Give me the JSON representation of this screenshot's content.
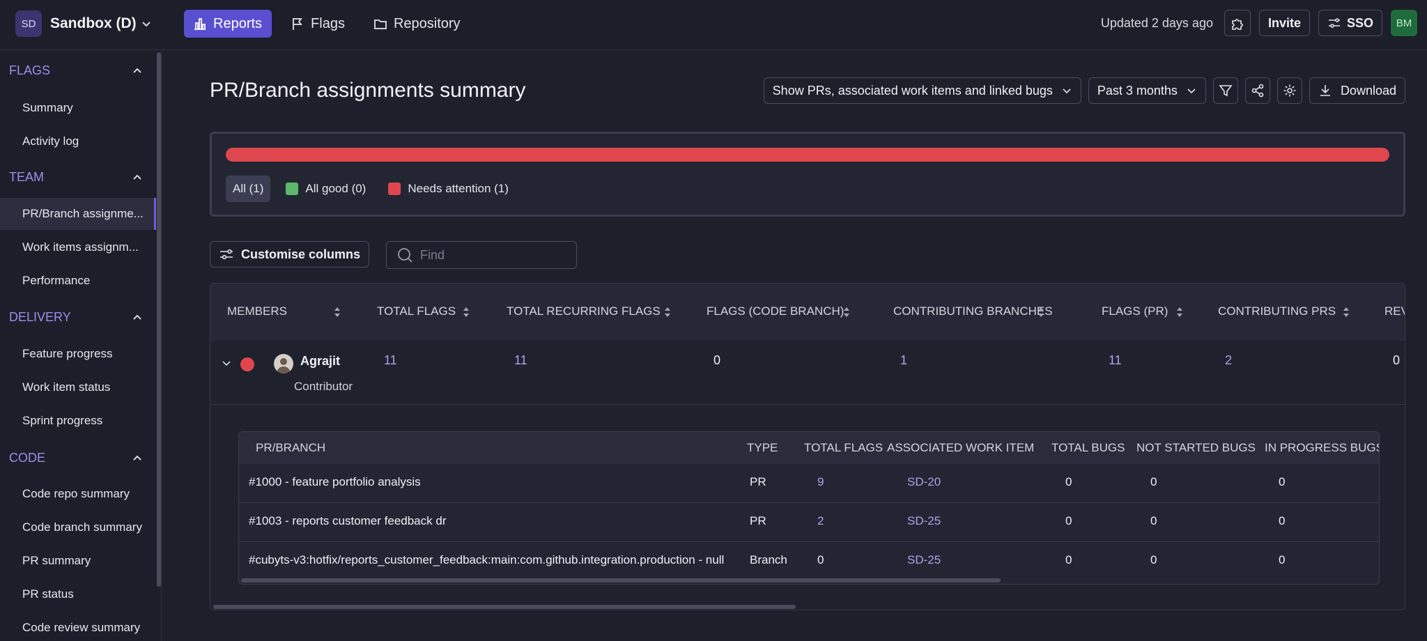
{
  "topbar": {
    "workspace_badge": "SD",
    "workspace_name": "Sandbox (D)",
    "nav": [
      {
        "label": "Reports",
        "icon": "bar-chart-icon",
        "active": true
      },
      {
        "label": "Flags",
        "icon": "flag-icon",
        "active": false
      },
      {
        "label": "Repository",
        "icon": "folder-icon",
        "active": false
      }
    ],
    "updated": "Updated 2 days ago",
    "invite_label": "Invite",
    "sso_label": "SSO",
    "user_initials": "BM"
  },
  "sidebar": {
    "sections": [
      {
        "title": "FLAGS",
        "items": [
          "Summary",
          "Activity log"
        ]
      },
      {
        "title": "TEAM",
        "items": [
          "PR/Branch assignme...",
          "Work items assignm...",
          "Performance"
        ]
      },
      {
        "title": "DELIVERY",
        "items": [
          "Feature progress",
          "Work item status",
          "Sprint progress"
        ]
      },
      {
        "title": "CODE",
        "items": [
          "Code repo summary",
          "Code branch summary",
          "PR summary",
          "PR status",
          "Code review summary"
        ]
      }
    ],
    "active_item": "PR/Branch assignme..."
  },
  "page": {
    "title": "PR/Branch assignments summary",
    "scope_dropdown": "Show PRs, associated work items and linked bugs",
    "range_dropdown": "Past 3 months",
    "download_label": "Download"
  },
  "summary": {
    "attention_fraction": 1.0,
    "filters": [
      {
        "label": "All (1)",
        "color": null,
        "active": true
      },
      {
        "label": "All good (0)",
        "color": "#5cb86a",
        "active": false
      },
      {
        "label": "Needs attention (1)",
        "color": "#e0464d",
        "active": false
      }
    ]
  },
  "tools": {
    "customise_label": "Customise columns",
    "find_placeholder": "Find"
  },
  "table": {
    "columns": [
      "MEMBERS",
      "TOTAL FLAGS",
      "TOTAL RECURRING FLAGS",
      "FLAGS (CODE BRANCH)",
      "CONTRIBUTING BRANCHES",
      "FLAGS (PR)",
      "CONTRIBUTING PRS",
      "REV"
    ],
    "rows": [
      {
        "name": "Agrajit",
        "role": "Contributor",
        "status_color": "#e0464d",
        "values": [
          "11",
          "11",
          "0",
          "1",
          "11",
          "2",
          "0"
        ]
      }
    ]
  },
  "detail": {
    "columns": [
      "PR/BRANCH",
      "TYPE",
      "TOTAL FLAGS",
      "ASSOCIATED WORK ITEM",
      "TOTAL BUGS",
      "NOT STARTED BUGS",
      "IN PROGRESS BUGS"
    ],
    "rows": [
      {
        "branch": "#1000 - feature portfolio analysis",
        "type": "PR",
        "flags": "9",
        "work_item": "SD-20",
        "bugs": "0",
        "not_started": "0",
        "in_progress": "0"
      },
      {
        "branch": "#1003 - reports customer feedback dr",
        "type": "PR",
        "flags": "2",
        "work_item": "SD-25",
        "bugs": "0",
        "not_started": "0",
        "in_progress": "0"
      },
      {
        "branch": "#cubyts-v3:hotfix/reports_customer_feedback:main:com.github.integration.production - null",
        "type": "Branch",
        "flags": "0",
        "work_item": "SD-25",
        "bugs": "0",
        "not_started": "0",
        "in_progress": "0"
      }
    ]
  }
}
